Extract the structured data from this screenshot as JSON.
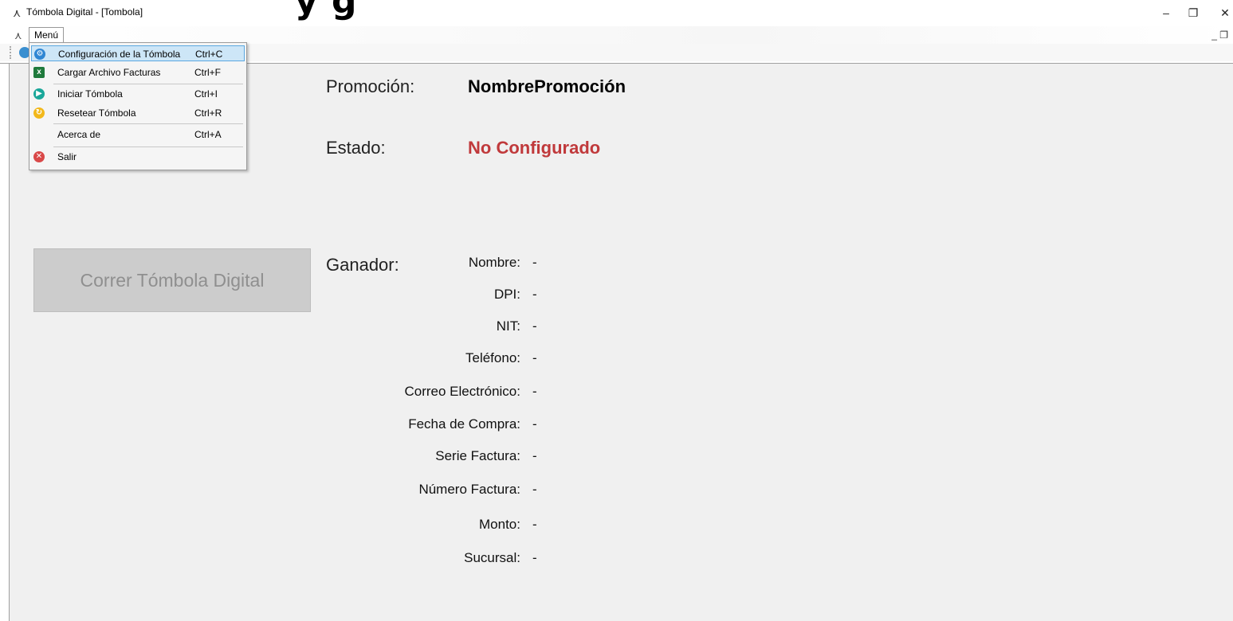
{
  "window": {
    "title": "Tómbola Digital - [Tombola]",
    "heading_fragment": "y g",
    "controls": {
      "minimize": "–",
      "maximize": "❐",
      "close": "✕"
    },
    "mdi_controls": "_ ❐"
  },
  "menubar": {
    "menu_label": "Menú"
  },
  "dropdown": {
    "items": [
      {
        "label": "Configuración de la Tómbola",
        "shortcut": "Ctrl+C",
        "icon": "gear-icon",
        "color": "#2f86d3",
        "selected": true
      },
      {
        "label": "Cargar Archivo Facturas",
        "shortcut": "Ctrl+F",
        "icon": "excel-icon",
        "color": "#1f7a3c"
      },
      {
        "label": "Iniciar Tómbola",
        "shortcut": "Ctrl+I",
        "icon": "play-icon",
        "color": "#1aa79a"
      },
      {
        "label": "Resetear Tómbola",
        "shortcut": "Ctrl+R",
        "icon": "reset-icon",
        "color": "#f2b81b"
      },
      {
        "label": "Acerca de",
        "shortcut": "Ctrl+A",
        "icon": "",
        "color": ""
      },
      {
        "label": "Salir",
        "shortcut": "",
        "icon": "close-circle-icon",
        "color": "#d94848"
      }
    ]
  },
  "main": {
    "promocion_label": "Promoción:",
    "promocion_value": "NombrePromoción",
    "estado_label": "Estado:",
    "estado_value": "No Configurado",
    "estado_color": "#c0393b",
    "run_button": "Correr Tómbola Digital",
    "ganador_label": "Ganador:",
    "fields": [
      {
        "label": "Nombre:",
        "value": "-"
      },
      {
        "label": "DPI:",
        "value": "-"
      },
      {
        "label": "NIT:",
        "value": "-"
      },
      {
        "label": "Teléfono:",
        "value": "-"
      },
      {
        "label": "Correo Electrónico:",
        "value": "-"
      },
      {
        "label": "Fecha de Compra:",
        "value": "-"
      },
      {
        "label": "Serie Factura:",
        "value": "-"
      },
      {
        "label": "Número Factura:",
        "value": "-"
      },
      {
        "label": "Monto:",
        "value": "-"
      },
      {
        "label": "Sucursal:",
        "value": "-"
      }
    ]
  }
}
